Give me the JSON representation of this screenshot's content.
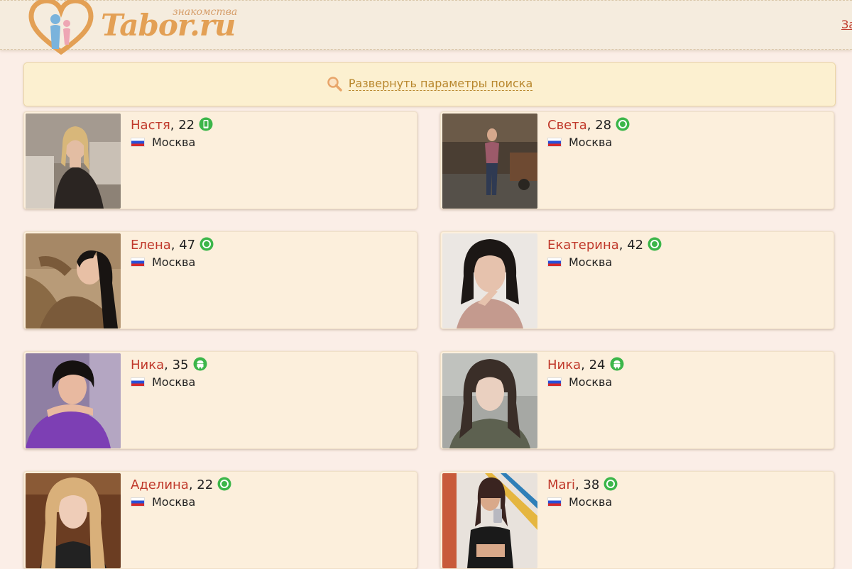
{
  "header": {
    "logo_text": "Tabor.ru",
    "logo_subtitle": "знакомства",
    "right_link": "За"
  },
  "search": {
    "toggle_label": "Развернуть параметры поиска"
  },
  "colors": {
    "name": "#c0392b",
    "online": "#3cb64a",
    "accent": "#e3a055",
    "card_bg": "#fcefdc",
    "page_bg": "#fbeee7"
  },
  "profiles": [
    {
      "name": "Настя",
      "age_text": ", 22",
      "city": "Москва",
      "status_icon": "mobile-online-icon"
    },
    {
      "name": "Света",
      "age_text": ", 28",
      "city": "Москва",
      "status_icon": "online-dot-icon"
    },
    {
      "name": "Елена",
      "age_text": ", 47",
      "city": "Москва",
      "status_icon": "online-dot-icon"
    },
    {
      "name": "Екатерина",
      "age_text": ", 42",
      "city": "Москва",
      "status_icon": "online-dot-icon"
    },
    {
      "name": "Ника",
      "age_text": ", 35",
      "city": "Москва",
      "status_icon": "android-online-icon"
    },
    {
      "name": "Ника",
      "age_text": ", 24",
      "city": "Москва",
      "status_icon": "android-online-icon"
    },
    {
      "name": "Аделина",
      "age_text": ", 22",
      "city": "Москва",
      "status_icon": "online-dot-icon"
    },
    {
      "name": "Mari",
      "age_text": ", 38",
      "city": "Москва",
      "status_icon": "online-dot-icon"
    }
  ]
}
